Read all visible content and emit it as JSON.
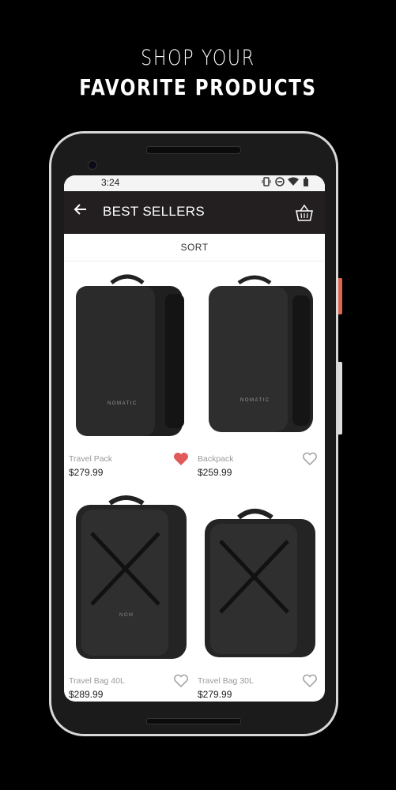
{
  "promo": {
    "line1": "SHOP YOUR",
    "line2": "FAVORITE PRODUCTS"
  },
  "status": {
    "time": "3:24",
    "icons": [
      "vibrate-icon",
      "dnd-icon",
      "wifi-icon",
      "battery-icon"
    ]
  },
  "appbar": {
    "title": "BEST SELLERS",
    "back_icon": "arrow-left-icon",
    "cart_icon": "basket-icon"
  },
  "sort": {
    "label": "SORT"
  },
  "products": [
    {
      "name": "Travel Pack",
      "price": "$279.99",
      "favorited": true
    },
    {
      "name": "Backpack",
      "price": "$259.99",
      "favorited": false
    },
    {
      "name": "Travel Bag 40L",
      "price": "$289.99",
      "favorited": false
    },
    {
      "name": "Travel Bag 30L",
      "price": "$279.99",
      "favorited": false
    }
  ],
  "colors": {
    "appbar": "#231f20",
    "heart_active": "#e05a5a",
    "heart_inactive": "#9a9a9a"
  }
}
